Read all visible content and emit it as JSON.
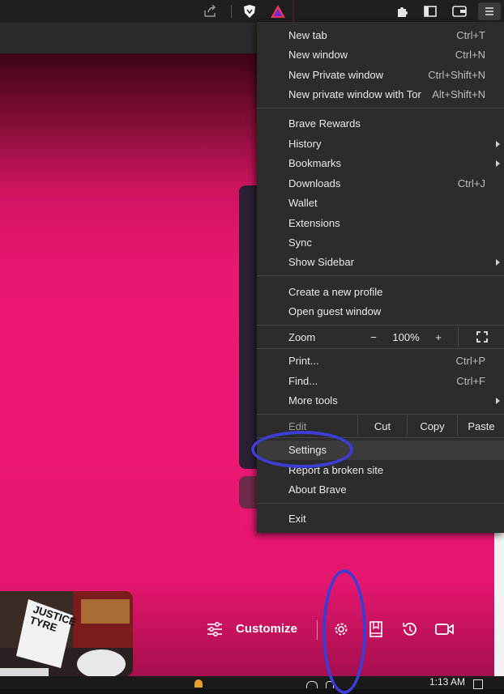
{
  "menu": {
    "items": [
      {
        "label": "New tab",
        "shortcut": "Ctrl+T"
      },
      {
        "label": "New window",
        "shortcut": "Ctrl+N"
      },
      {
        "label": "New Private window",
        "shortcut": "Ctrl+Shift+N"
      },
      {
        "label": "New private window with Tor",
        "shortcut": "Alt+Shift+N"
      },
      {
        "label": "Brave Rewards",
        "shortcut": ""
      },
      {
        "label": "History",
        "shortcut": ""
      },
      {
        "label": "Bookmarks",
        "shortcut": ""
      },
      {
        "label": "Downloads",
        "shortcut": "Ctrl+J"
      },
      {
        "label": "Wallet",
        "shortcut": ""
      },
      {
        "label": "Extensions",
        "shortcut": ""
      },
      {
        "label": "Sync",
        "shortcut": ""
      },
      {
        "label": "Show Sidebar",
        "shortcut": ""
      },
      {
        "label": "Create a new profile",
        "shortcut": ""
      },
      {
        "label": "Open guest window",
        "shortcut": ""
      },
      {
        "label": "Print...",
        "shortcut": "Ctrl+P"
      },
      {
        "label": "Find...",
        "shortcut": "Ctrl+F"
      },
      {
        "label": "More tools",
        "shortcut": ""
      },
      {
        "label": "Settings",
        "shortcut": ""
      },
      {
        "label": "Report a broken site",
        "shortcut": ""
      },
      {
        "label": "About Brave",
        "shortcut": ""
      },
      {
        "label": "Exit",
        "shortcut": ""
      }
    ],
    "zoom": {
      "label": "Zoom",
      "minus": "−",
      "value": "100%",
      "plus": "+"
    },
    "edit": {
      "label": "Edit",
      "cut": "Cut",
      "copy": "Copy",
      "paste": "Paste"
    }
  },
  "bottom_bar": {
    "customize_label": "Customize"
  },
  "photo": {
    "sign_text": "JUSTICE TYRE"
  },
  "taskbar": {
    "clock": "1:13 AM"
  },
  "annotation_color": "#3d3dd6",
  "icons": [
    "share-icon",
    "brave-shields-icon",
    "brave-rewards-icon",
    "puzzle-icon",
    "sidebar-icon",
    "wallet-icon",
    "hamburger-menu-icon",
    "sliders-icon",
    "gear-icon",
    "bookmark-icon",
    "history-icon",
    "video-icon",
    "fullscreen-icon",
    "submenu-arrow-icon"
  ]
}
